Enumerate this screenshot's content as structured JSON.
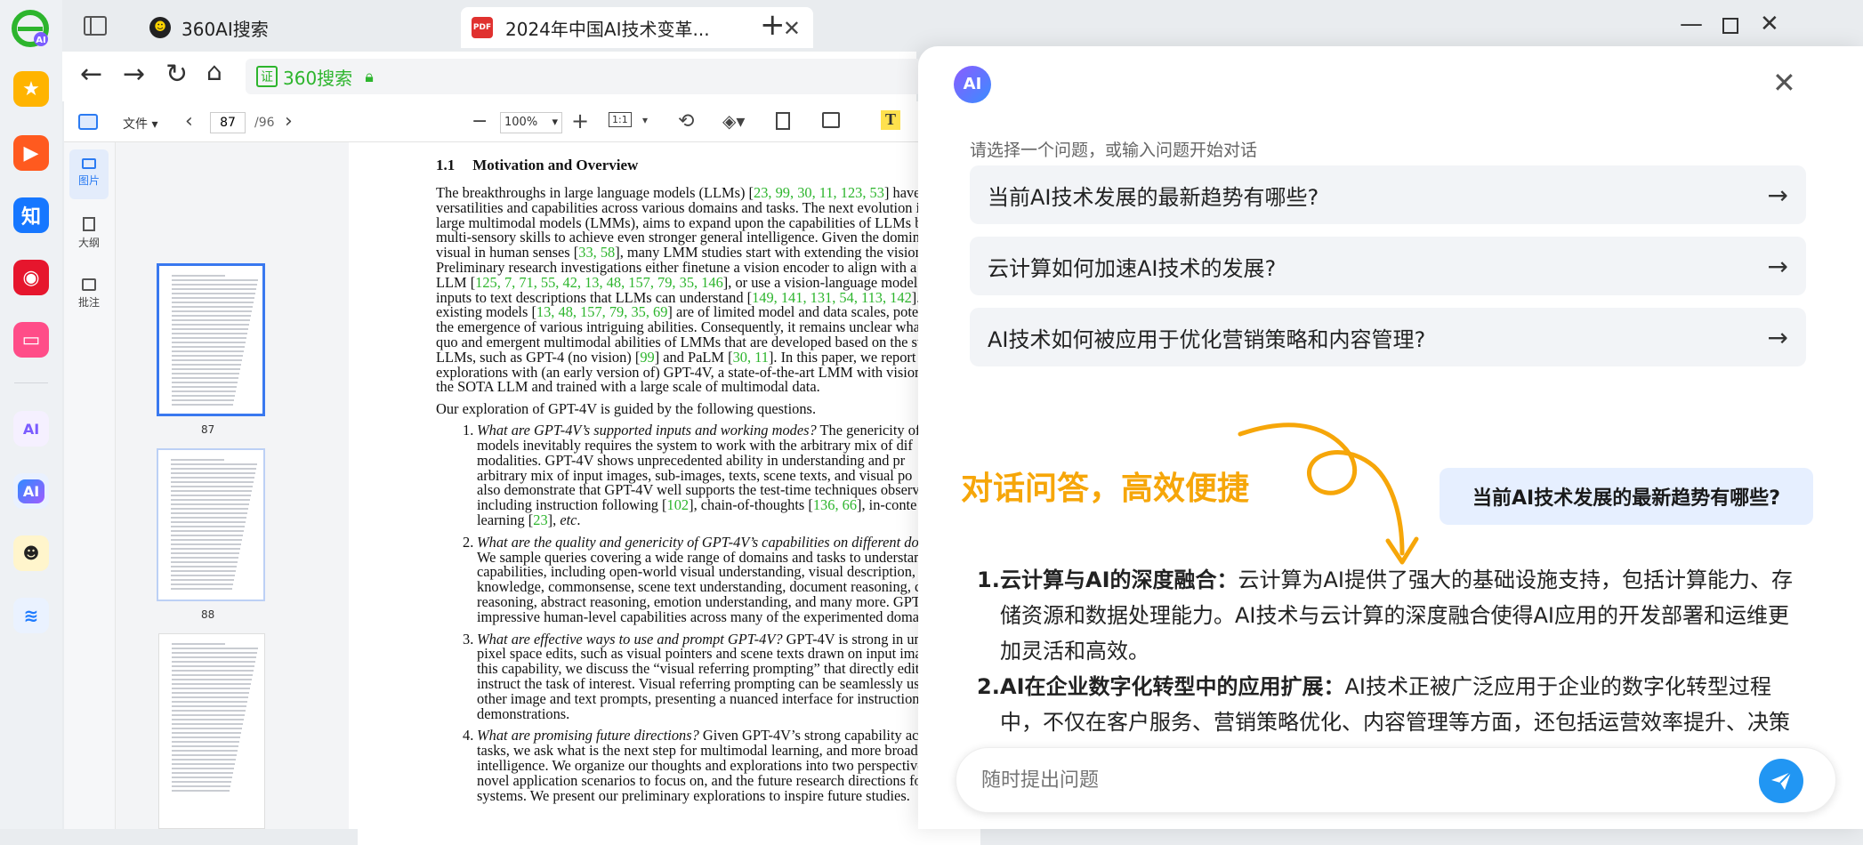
{
  "browser": {
    "tabs": [
      {
        "label": "360AI搜索",
        "active": false
      },
      {
        "label": "2024年中国AI技术变革...",
        "active": true
      }
    ],
    "address": {
      "verify_badge": "证",
      "site": "360搜索"
    }
  },
  "pdf_toolbar": {
    "file_menu": "文件",
    "page_current": "87",
    "page_total": "/96",
    "zoom": "100%"
  },
  "pdf_sidebar": {
    "items": [
      {
        "label": "图片"
      },
      {
        "label": "大纲"
      },
      {
        "label": "批注"
      }
    ]
  },
  "thumbnails": {
    "pages": [
      "87",
      "88"
    ]
  },
  "pdf_content": {
    "section_number": "1.1",
    "section_title": "Motivation and Overview",
    "para1": [
      [
        "The breakthroughs in large language models (LLMs) [",
        "23, 99, 30, 11, 123, 53",
        "] have shown"
      ],
      [
        "versatilities and capabilities across various domains and tasks.  The next evolution i",
        "",
        ""
      ],
      [
        "large multimodal models (LMMs), aims to expand upon the capabilities of LLMs by",
        "",
        ""
      ],
      [
        "multi-sensory skills to achieve even stronger general intelligence.  Given the domin",
        "",
        ""
      ],
      [
        "visual in human senses [",
        "33, 58",
        "], many LMM studies start with extending the vision"
      ],
      [
        "Preliminary research investigations either finetune a vision encoder to align with a frozen",
        "",
        ""
      ],
      [
        "LLM [",
        "125, 7, 71, 55, 42, 13, 48, 157, 79, 35, 146",
        "], or use a vision-language model to co"
      ],
      [
        "inputs to text descriptions that LLMs can understand [",
        "149, 141, 131, 54, 113, 142",
        "]. Ho"
      ],
      [
        "existing models [",
        "13, 48, 157, 79, 35, 69",
        "] are of limited model and data scales, potentiall"
      ],
      [
        "the emergence of various intriguing abilities. Consequently, it remains unclear what a",
        "",
        ""
      ],
      [
        "quo and emergent multimodal abilities of LMMs that are developed based on the stat",
        "",
        ""
      ],
      [
        "LLMs, such as GPT-4 (no vision) [",
        "99",
        "] and PaLM ["
      ],
      [
        "explorations with (an early version of) GPT-4V, a state-of-the-art LMM with vision, bu",
        "",
        ""
      ],
      [
        "the SOTA LLM and trained with a large scale of multimodal data.",
        "",
        ""
      ]
    ],
    "para1_l12_tail": [
      "30, 11",
      "]. In this paper, we report our"
    ],
    "para2": "Our exploration of GPT-4V is guided by the following questions.",
    "list": [
      {
        "num": "1.",
        "lines": [
          [
            [
              "i",
              "What are GPT-4V’s supported inputs and working modes?"
            ],
            [
              "n",
              " The genericity of"
            ]
          ],
          [
            [
              "n",
              "models inevitably requires the system to work with the arbitrary mix of dif"
            ]
          ],
          [
            [
              "n",
              "modalities.  GPT-4V shows unprecedented ability in understanding and pr"
            ]
          ],
          [
            [
              "n",
              "arbitrary mix of input images, sub-images, texts, scene texts, and visual po"
            ]
          ],
          [
            [
              "n",
              "also demonstrate that GPT-4V well supports the test-time techniques observe"
            ]
          ],
          [
            [
              "n",
              "including instruction following ["
            ],
            [
              "r",
              "102"
            ],
            [
              "n",
              "], chain-of-thoughts ["
            ],
            [
              "r",
              "136, 66"
            ],
            [
              "n",
              "], in-conte"
            ]
          ],
          [
            [
              "n",
              "learning ["
            ],
            [
              "r",
              "23"
            ],
            [
              "n",
              "], "
            ],
            [
              "i",
              "etc"
            ],
            [
              "n",
              "."
            ]
          ]
        ]
      },
      {
        "num": "2.",
        "lines": [
          [
            [
              "i",
              "What are the quality and genericity of GPT-4V’s capabilities on different domain"
            ]
          ],
          [
            [
              "n",
              "We sample queries covering a wide range of domains and tasks to understan"
            ]
          ],
          [
            [
              "n",
              "capabilities, including open-world visual understanding, visual description,"
            ]
          ],
          [
            [
              "n",
              "knowledge, commonsense, scene text understanding, document reasoning, codi"
            ]
          ],
          [
            [
              "n",
              "reasoning, abstract reasoning, emotion understanding, and many more.  GPT"
            ]
          ],
          [
            [
              "n",
              "impressive human-level capabilities across many of the experimented domains"
            ]
          ]
        ]
      },
      {
        "num": "3.",
        "lines": [
          [
            [
              "i",
              "What are effective ways to use and prompt GPT-4V?"
            ],
            [
              "n",
              " GPT-4V is strong in un"
            ]
          ],
          [
            [
              "n",
              "pixel space edits, such as visual pointers and scene texts drawn on input images."
            ]
          ],
          [
            [
              "n",
              "this capability, we discuss the “visual referring prompting” that directly edits inp"
            ]
          ],
          [
            [
              "n",
              "instruct the task of interest. Visual referring prompting can be seamlessly used t"
            ]
          ],
          [
            [
              "n",
              "other image and text prompts, presenting a nuanced interface for instruction a"
            ]
          ],
          [
            [
              "n",
              "demonstrations."
            ]
          ]
        ]
      },
      {
        "num": "4.",
        "lines": [
          [
            [
              "i",
              "What are promising future directions?"
            ],
            [
              "n",
              " Given GPT-4V’s strong capability across d"
            ]
          ],
          [
            [
              "n",
              "tasks, we ask what is the next step for multimodal learning, and more broadly"
            ]
          ],
          [
            [
              "n",
              "intelligence. We organize our thoughts and explorations into two perspectives, "
            ],
            [
              "i",
              "i."
            ]
          ],
          [
            [
              "n",
              "novel application scenarios to focus on, and the future research directions for GP"
            ]
          ],
          [
            [
              "n",
              "systems. We present our preliminary explorations to inspire future studies."
            ]
          ]
        ]
      }
    ]
  },
  "ai_panel": {
    "logo_text": "AI",
    "prompt_text": "请选择一个问题，或输入问题开始对话",
    "questions": [
      "当前AI技术发展的最新趋势有哪些?",
      "云计算如何加速AI技术的发展?",
      "AI技术如何被应用于优化营销策略和内容管理?"
    ],
    "promo_headline": "对话问答，高效便捷",
    "sample_question": "当前AI技术发展的最新趋势有哪些?",
    "answers": [
      {
        "num": "1.",
        "bold": "云计算与AI的深度融合：",
        "lines": [
          "云计算为AI提供了强大的基础设施支持，包括计算能力、存",
          "储资源和数据处理能力。AI技术与云计算的深度融合使得AI应用的开发部署和运维更",
          "加灵活和高效。"
        ]
      },
      {
        "num": "2.",
        "bold": "AI在企业数字化转型中的应用扩展：",
        "lines": [
          "AI技术正被广泛应用于企业的数字化转型过程",
          "中，不仅在客户服务、营销策略优化、内容管理等方面，还包括运营效率提升、决策"
        ]
      }
    ],
    "input_placeholder": "随时提出问题"
  },
  "colors": {
    "accent": "#2196f3",
    "promo": "#f6a609",
    "green": "#2db52d"
  }
}
